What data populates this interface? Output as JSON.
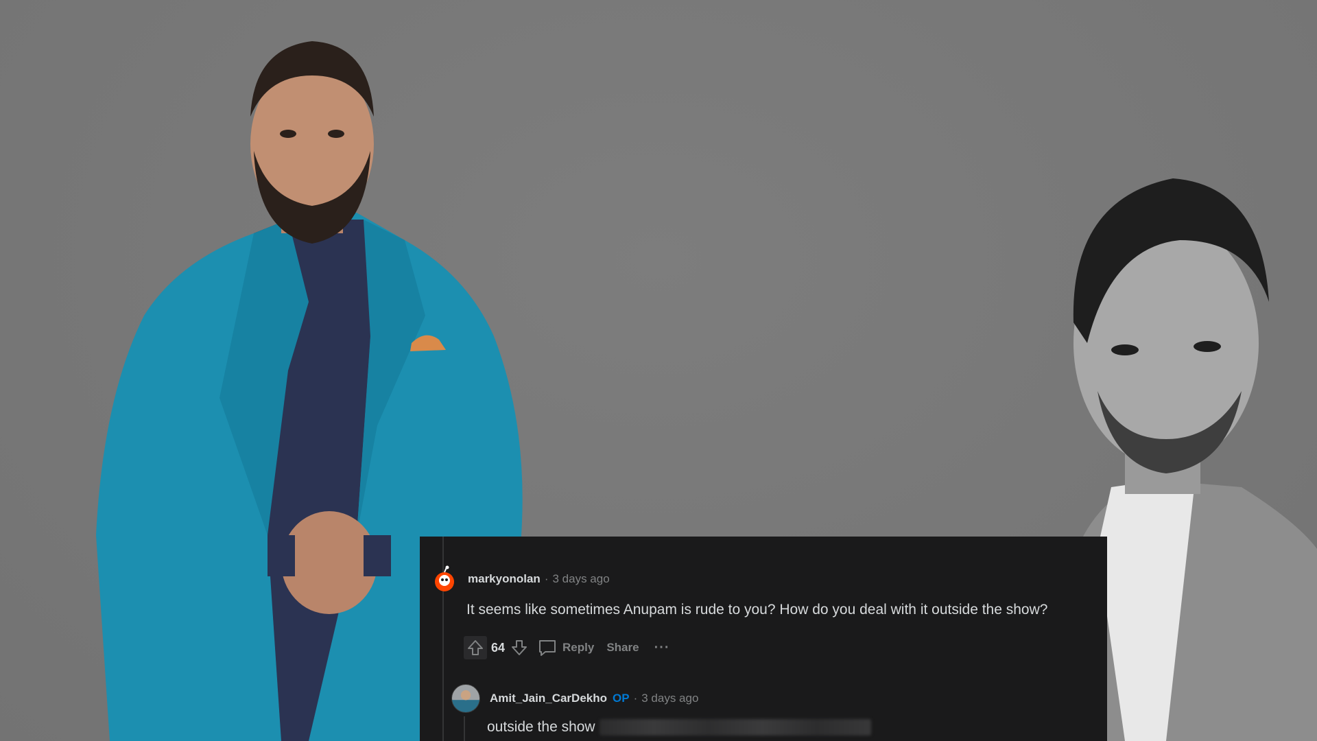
{
  "colors": {
    "background": "#7a7a7a",
    "card": "#1a1a1b",
    "text_primary": "#d7dadc",
    "text_muted": "#818384",
    "op_accent": "#0079d3",
    "suit_teal": "#1c8fb0",
    "shirt_navy": "#2b3352"
  },
  "comment": {
    "author": "markyonolan",
    "separator": "·",
    "time": "3 days ago",
    "avatar_icon": "snoo-avatar-icon",
    "body": "It seems like sometimes Anupam is rude to you? How do you deal with it outside the show?",
    "score": "64",
    "reply_label": "Reply",
    "share_label": "Share",
    "more_label": "···"
  },
  "reply": {
    "author": "Amit_Jain_CarDekho",
    "badge": "OP",
    "separator": "·",
    "time": "3 days ago",
    "avatar_icon": "profile-photo-avatar",
    "body": "outside the show"
  }
}
